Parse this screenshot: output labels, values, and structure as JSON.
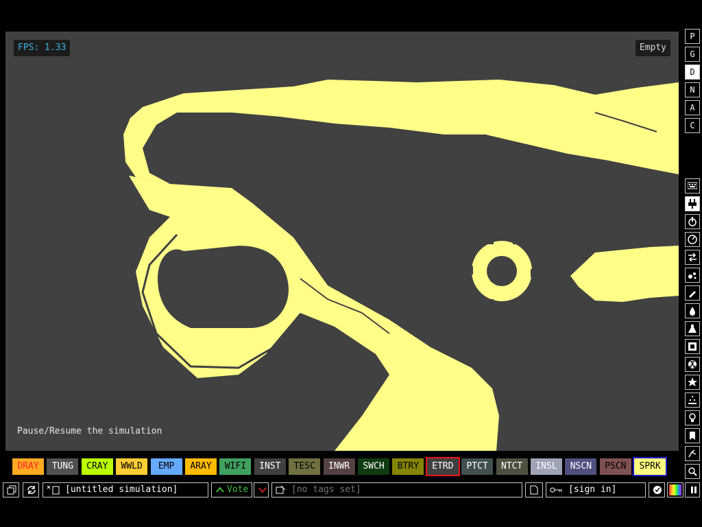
{
  "hud": {
    "fps": "FPS: 1.33",
    "place": "Empty",
    "tooltip": "Pause/Resume the simulation"
  },
  "colors": {
    "background": "#000000",
    "sim_background": "#414141",
    "material": "#ffff88",
    "fps_text": "#3ab3e0"
  },
  "menu_letters": [
    "P",
    "G",
    "D",
    "N",
    "A",
    "C"
  ],
  "active_menu_letter": "D",
  "category_icons": [
    "keyboard-icon",
    "plug-icon",
    "power-icon",
    "gauge-icon",
    "arrows-icon",
    "particles-icon",
    "pen-icon",
    "droplet-icon",
    "flask-icon",
    "square-icon",
    "radiation-icon",
    "star-icon",
    "dots-icon",
    "bulb-icon",
    "bookmark-icon",
    "hand-icon",
    "search-icon"
  ],
  "active_category": "plug-icon",
  "elements": [
    {
      "label": "DRAY",
      "bg": "#ffaa22",
      "fg": "#ff2222"
    },
    {
      "label": "TUNG",
      "bg": "#505050",
      "fg": "#ffffff"
    },
    {
      "label": "CRAY",
      "bg": "#bbff00",
      "fg": "#000000"
    },
    {
      "label": "WWLD",
      "bg": "#ffcc33",
      "fg": "#000000"
    },
    {
      "label": "EMP",
      "bg": "#66aaff",
      "fg": "#000000"
    },
    {
      "label": "ARAY",
      "bg": "#ffbb00",
      "fg": "#000000"
    },
    {
      "label": "WIFI",
      "bg": "#40a060",
      "fg": "#000000"
    },
    {
      "label": "INST",
      "bg": "#404040",
      "fg": "#ffffff"
    },
    {
      "label": "TESC",
      "bg": "#707040",
      "fg": "#000000"
    },
    {
      "label": "INWR",
      "bg": "#544141",
      "fg": "#ffffff"
    },
    {
      "label": "SWCH",
      "bg": "#103b11",
      "fg": "#ffffff"
    },
    {
      "label": "BTRY",
      "bg": "#858505",
      "fg": "#000000"
    },
    {
      "label": "ETRD",
      "bg": "#404040",
      "fg": "#ffffff",
      "selected": "left"
    },
    {
      "label": "PTCT",
      "bg": "#405050",
      "fg": "#ffffff"
    },
    {
      "label": "NTCT",
      "bg": "#505040",
      "fg": "#ffffff"
    },
    {
      "label": "INSL",
      "bg": "#9ea3b6",
      "fg": "#ffffff"
    },
    {
      "label": "NSCN",
      "bg": "#505080",
      "fg": "#ffffff"
    },
    {
      "label": "PSCN",
      "bg": "#805050",
      "fg": "#000000"
    },
    {
      "label": "SPRK",
      "bg": "#ffff80",
      "fg": "#000000",
      "selected": "right"
    }
  ],
  "bottom": {
    "save_name": "[untitled simulation]",
    "vote": "Vote",
    "tags": "[no tags set]",
    "signin": "[sign in]"
  }
}
